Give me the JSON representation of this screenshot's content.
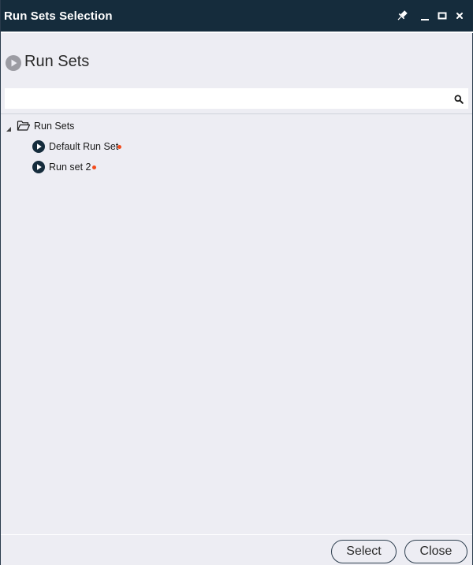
{
  "window": {
    "title": "Run Sets Selection",
    "controls": [
      "pin-icon",
      "minimize-icon",
      "maximize-icon",
      "close-icon"
    ]
  },
  "header": {
    "title": "Run Sets",
    "icon": "play-circle-icon"
  },
  "search": {
    "value": "",
    "placeholder": "",
    "icon": "search-icon"
  },
  "tree": {
    "root": {
      "label": "Run Sets",
      "expanded": true,
      "icon": "folder-open-icon"
    },
    "items": [
      {
        "label": "Default Run Set",
        "icon": "run-icon",
        "modified": true
      },
      {
        "label": "Run set 2",
        "icon": "run-icon",
        "modified": true
      }
    ]
  },
  "footer": {
    "select_label": "Select",
    "close_label": "Close"
  },
  "colors": {
    "titlebar": "#152c3c",
    "background": "#ededf3",
    "modified_dot": "#f24a1b",
    "run_icon": "#152c3c"
  }
}
